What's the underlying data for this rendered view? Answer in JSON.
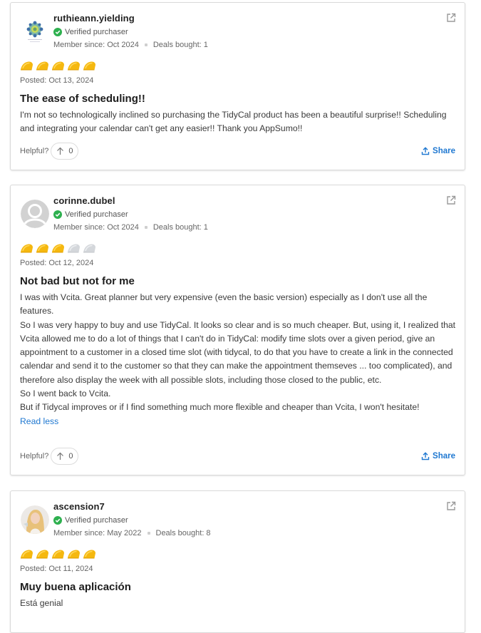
{
  "colors": {
    "taco_filled": "#f5b80f",
    "taco_empty": "#d4d7db",
    "verified": "#2eb04f",
    "link": "#1f78d1"
  },
  "reviews": [
    {
      "username": "ruthieann.yielding",
      "avatar": "logo-avatar",
      "verified_label": "Verified purchaser",
      "member_since": "Member since: Oct 2024",
      "deals_bought": "Deals bought: 1",
      "rating": 5,
      "rating_max": 5,
      "posted": "Posted: Oct 13, 2024",
      "title": "The ease of scheduling!!",
      "body": [
        "I'm not so technologically inclined so purchasing the TidyCal product has been a beautiful surprise!! Scheduling and integrating your calendar can't get any easier!! Thank you AppSumo!!"
      ],
      "helpful_label": "Helpful?",
      "helpful_count": "0",
      "share_label": "Share"
    },
    {
      "username": "corinne.dubel",
      "avatar": "default-avatar",
      "verified_label": "Verified purchaser",
      "member_since": "Member since: Oct 2024",
      "deals_bought": "Deals bought: 1",
      "rating": 3,
      "rating_max": 5,
      "posted": "Posted: Oct 12, 2024",
      "title": "Not bad but not for me",
      "body": [
        "I was with Vcita. Great planner but very expensive (even the basic version) especially as I don't use all the features.",
        "So I was very happy to buy and use TidyCal. It looks so clear and is so much cheaper. But, using it, I realized that Vcita allowed me to do a lot of things that I can't do in TidyCal: modify time slots over a given period, give an appointment to a customer in a closed time slot (with tidycal, to do that you have to create a link in the connected calendar and send it to the customer so that they can make the appointment themseves ... too complicated), and therefore also display the week with all possible slots, including those closed to the public, etc.",
        "So I went back to Vcita.",
        "But if Tidycal improves or if I find something much more flexible and cheaper than Vcita, I won't hesitate!"
      ],
      "read_less_label": "Read less",
      "helpful_label": "Helpful?",
      "helpful_count": "0",
      "share_label": "Share"
    },
    {
      "username": "ascension7",
      "avatar": "photo-avatar",
      "verified_label": "Verified purchaser",
      "member_since": "Member since: May 2022",
      "deals_bought": "Deals bought: 8",
      "rating": 5,
      "rating_max": 5,
      "posted": "Posted: Oct 11, 2024",
      "title": "Muy buena aplicación",
      "body": [
        "Está genial"
      ]
    }
  ]
}
